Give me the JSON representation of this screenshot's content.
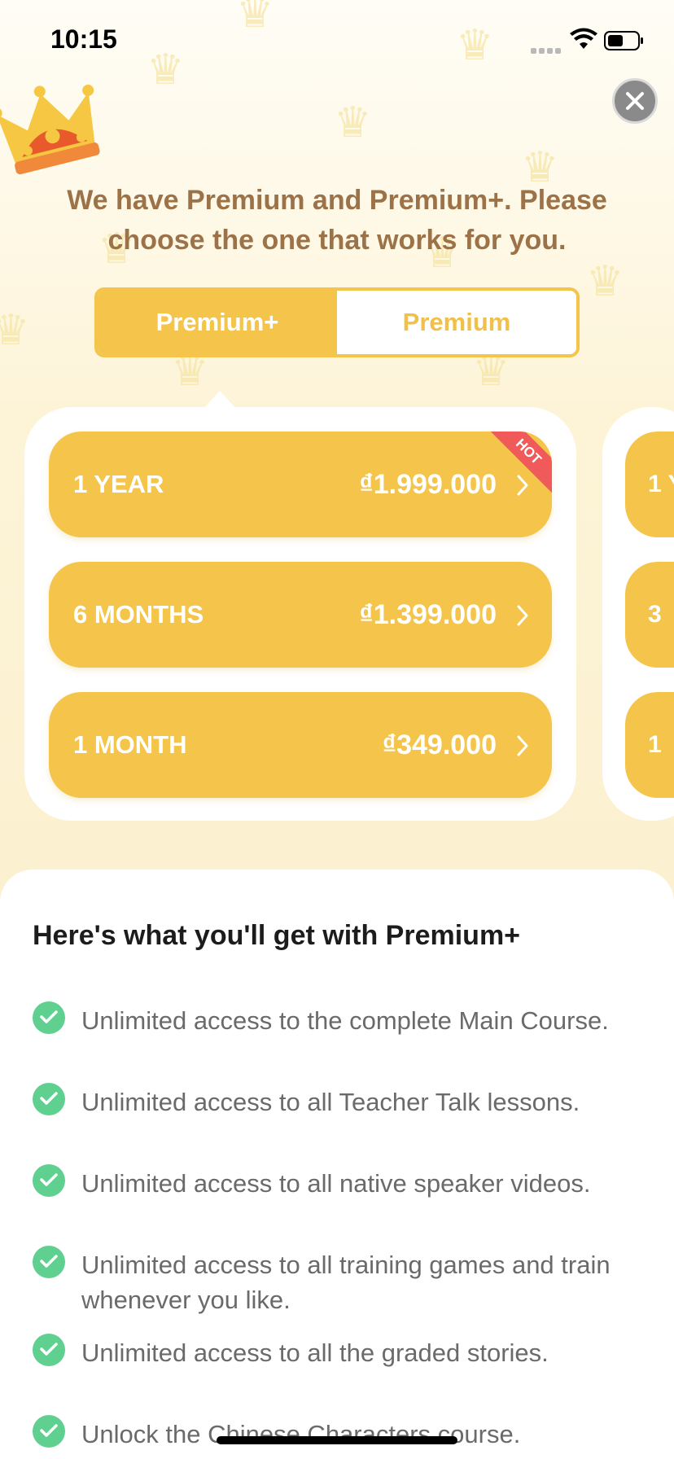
{
  "status_bar": {
    "time": "10:15"
  },
  "headline": "We have Premium and Premium+. Please choose the one that works for you.",
  "toggle": {
    "active_label": "Premium+",
    "inactive_label": "Premium",
    "selected": "Premium+"
  },
  "plans": [
    {
      "name": "1 YEAR",
      "price": "₫1.999.000",
      "badge": "HOT"
    },
    {
      "name": "6 MONTHS",
      "price": "₫1.399.000"
    },
    {
      "name": "1 MONTH",
      "price": "₫349.000"
    }
  ],
  "next_card_preview": [
    "1 Y",
    "3",
    "1"
  ],
  "benefits": {
    "title": "Here's what you'll get with Premium+",
    "items": [
      "Unlimited access to the complete Main Course.",
      "Unlimited access to all Teacher Talk lessons.",
      "Unlimited access to all native speaker videos.",
      "Unlimited access to all training games and train whenever you like.",
      "Unlimited access to all the graded stories.",
      "Unlock the Chinese Characters course."
    ]
  },
  "colors": {
    "accent": "#f4c54a",
    "headline": "#9c7248",
    "check": "#5fd08f",
    "hot": "#f05a5a"
  },
  "icons": [
    "close-icon",
    "crown-icon",
    "wifi-icon",
    "battery-icon",
    "chevron-right-icon",
    "check-icon"
  ]
}
